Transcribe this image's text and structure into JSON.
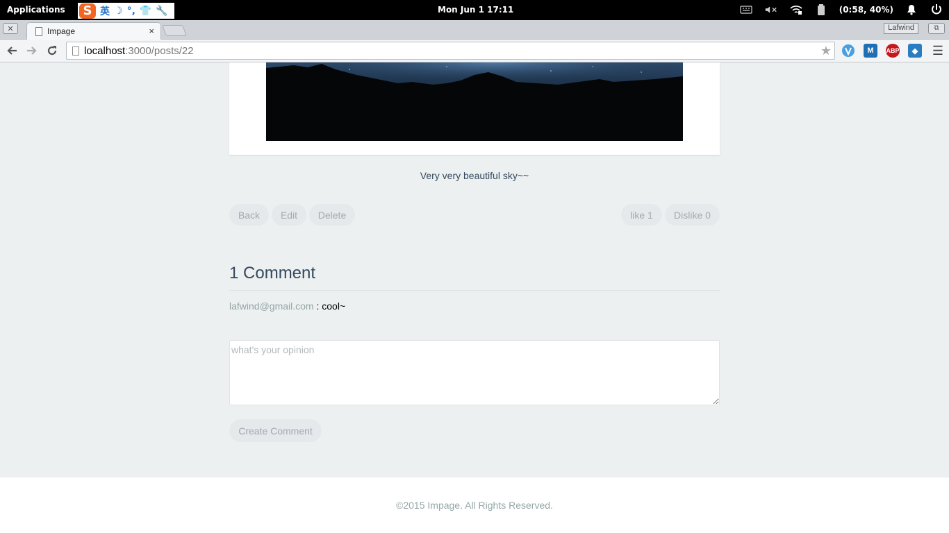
{
  "system_panel": {
    "applications_label": "Applications",
    "ime_logo": "S",
    "ime_items": [
      "英",
      "☽",
      "°,",
      "👕",
      "🔧"
    ],
    "datetime": "Mon Jun  1   17:11",
    "battery": "(0:58, 40%)",
    "icons": [
      "keyboard-icon",
      "mute-icon",
      "wifi-icon",
      "battery-icon",
      "bell-icon",
      "power-icon"
    ]
  },
  "browser": {
    "tab_title": "Impage",
    "tab_close": "×",
    "window_close": "✕",
    "profile_name": "Lafwind",
    "url_host": "localhost",
    "url_path": ":3000/posts/22",
    "extensions": [
      {
        "name": "vimium-icon",
        "label": "V",
        "color": "#4a9fe0"
      },
      {
        "name": "m-extension-icon",
        "label": "M",
        "color": "#1f6fb5"
      },
      {
        "name": "adblock-plus-icon",
        "label": "ABP",
        "color": "#c7171e"
      },
      {
        "name": "dropbox-icon",
        "label": "◆",
        "color": "#2b7dc1"
      }
    ]
  },
  "post": {
    "caption": "Very very beautiful sky~~",
    "actions": {
      "back": "Back",
      "edit": "Edit",
      "delete": "Delete",
      "like": "like 1",
      "dislike": "Dislike 0"
    }
  },
  "comments": {
    "title": "1 Comment",
    "items": [
      {
        "author": "lafwind@gmail.com",
        "separator": " : ",
        "text": "cool~"
      }
    ],
    "input_placeholder": "what's your opinion",
    "input_value": "",
    "submit_label": "Create Comment"
  },
  "footer": {
    "copyright": "©2015 Impage. All Rights Reserved."
  }
}
